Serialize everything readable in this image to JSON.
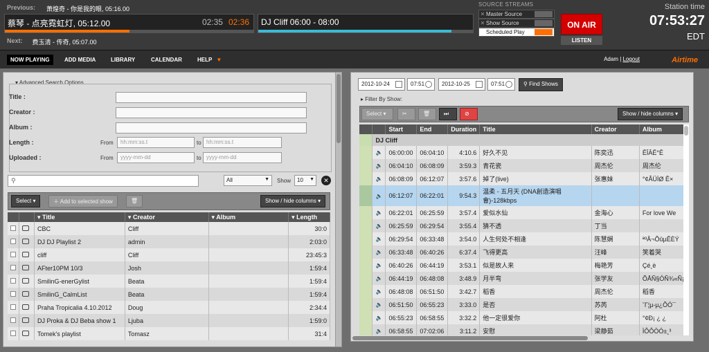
{
  "masthead": {
    "previous_label": "Previous:",
    "previous_text": "萧煌奇 - 你是我的眼, 05:16.00",
    "current_track": "蔡琴 - 点亮霓虹灯, 05:12.00",
    "current_elapsed": "02:35",
    "current_remaining": "02:36",
    "current_progress": 0.5,
    "current_show": "DJ Cliff  06:00 - 08:00",
    "show_progress": 0.9,
    "next_label": "Next:",
    "next_text": "费玉清 - 传奇, 05:07.00",
    "source_streams_title": "SOURCE STREAMS",
    "sources": [
      {
        "name": "Master Source",
        "on": false
      },
      {
        "name": "Show Source",
        "on": false
      },
      {
        "name": "Scheduled Play",
        "on": true
      }
    ],
    "on_air": "ON AIR",
    "listen": "LISTEN",
    "station_time_label": "Station time",
    "station_time": "07:53:27",
    "timezone": "EDT"
  },
  "nav": {
    "items": [
      "NOW PLAYING",
      "ADD MEDIA",
      "LIBRARY",
      "CALENDAR",
      "HELP"
    ],
    "user": "Adam",
    "separator": "|",
    "logout": "Logout",
    "brand": "Airtime"
  },
  "library": {
    "advanced_search": "Advanced Search Options",
    "fields": [
      "Title :",
      "Creator :",
      "Album :",
      "Length :",
      "Uploaded :"
    ],
    "from": "From",
    "to": "to",
    "length_placeholder": "hh:mm:ss.t",
    "date_placeholder": "yyyy-mm-dd",
    "filter_all": "All",
    "show_label": "Show",
    "show_count": "10",
    "select": "Select",
    "add_to_show": "Add to selected show",
    "show_hide": "Show / hide columns",
    "columns": [
      "Title",
      "Creator",
      "Album",
      "Length"
    ],
    "rows": [
      {
        "title": "CBC",
        "creator": "Cliff",
        "album": "",
        "length": "30:0"
      },
      {
        "title": "DJ DJ Playlist 2",
        "creator": "admin",
        "album": "",
        "length": "2:03:0"
      },
      {
        "title": "cliff",
        "creator": "Cliff",
        "album": "",
        "length": "23:45:3"
      },
      {
        "title": "AFter10PM 10/3",
        "creator": "Josh",
        "album": "",
        "length": "1:59:4"
      },
      {
        "title": "SmilinG-enerGylist",
        "creator": "Beata",
        "album": "",
        "length": "1:59:4"
      },
      {
        "title": "SmilinG_CalmList",
        "creator": "Beata",
        "album": "",
        "length": "1:59:4"
      },
      {
        "title": "Praha Tropicalia 4.10.2012",
        "creator": "Doug",
        "album": "",
        "length": "2:34:4"
      },
      {
        "title": "DJ Proka & DJ Beba show 1",
        "creator": "Ljuba",
        "album": "",
        "length": "1:59:0"
      },
      {
        "title": "Tomek's playlist",
        "creator": "Tomasz",
        "album": "",
        "length": "31:4"
      }
    ]
  },
  "schedule": {
    "start_date": "2012-10-24",
    "start_time": "07:51",
    "end_date": "2012-10-25",
    "end_time": "07:51",
    "find_shows": "Find Shows",
    "filter_by_show": "Filter By Show:",
    "select": "Select",
    "show_hide": "Show / hide columns",
    "columns": [
      "Start",
      "End",
      "Duration",
      "Title",
      "Creator",
      "Album"
    ],
    "show_name": "DJ Cliff",
    "rows": [
      {
        "start": "06:00:00",
        "end": "06:04:10",
        "dur": "4:10.6",
        "title": "好久不见",
        "creator": "陈奕迅",
        "album": "ÊÎÂÊ°Ê"
      },
      {
        "start": "06:04:10",
        "end": "06:08:09",
        "dur": "3:59.3",
        "title": "青花瓷",
        "creator": "周杰伦",
        "album": "周杰伦"
      },
      {
        "start": "06:08:09",
        "end": "06:12:07",
        "dur": "3:57.6",
        "title": "掉了(live)",
        "creator": "张惠妹",
        "album": "°¢ÃÜÌØ Ê×"
      },
      {
        "start": "06:12:07",
        "end": "06:22:01",
        "dur": "9:54.3",
        "title": "温柔 - 五月天 (DNA創造演唱會)-128kbps",
        "creator": "",
        "album": ""
      },
      {
        "start": "06:22:01",
        "end": "06:25:59",
        "dur": "3:57.4",
        "title": "爱似水仙",
        "creator": "金海心",
        "album": "For love We"
      },
      {
        "start": "06:25:59",
        "end": "06:29:54",
        "dur": "3:55.4",
        "title": "猜不透",
        "creator": "丁当",
        "album": ""
      },
      {
        "start": "06:29:54",
        "end": "06:33:48",
        "dur": "3:54.0",
        "title": "人生何处不相逢",
        "creator": "陈慧娴",
        "album": "ª³Â¬ÕûµÊÈÝ"
      },
      {
        "start": "06:33:48",
        "end": "06:40:26",
        "dur": "6:37.4",
        "title": "飞得更高",
        "creator": "汪峰",
        "album": "笑着哭"
      },
      {
        "start": "06:40:26",
        "end": "06:44:19",
        "dur": "3:53.1",
        "title": "似是故人来",
        "creator": "梅艳芳",
        "album": "Çé¸è"
      },
      {
        "start": "06:44:19",
        "end": "06:48:08",
        "dur": "3:48.9",
        "title": "月半弯",
        "creator": "张学友",
        "album": "ÕÅÑ§ÓÑ¾«Ñ¡"
      },
      {
        "start": "06:48:08",
        "end": "06:51:50",
        "dur": "3:42.7",
        "title": "稻香",
        "creator": "周杰伦",
        "album": "稻香"
      },
      {
        "start": "06:51:50",
        "end": "06:55:23",
        "dur": "3:33.0",
        "title": "是否",
        "creator": "苏芮",
        "album": "ˇΓ¦µ-µ¿ÕÓ¯"
      },
      {
        "start": "06:55:23",
        "end": "06:58:55",
        "dur": "3:32.2",
        "title": "他一定很爱你",
        "creator": "阿杜",
        "album": "°¢Ð¡ ¿ ¿"
      },
      {
        "start": "06:58:55",
        "end": "07:02:06",
        "dur": "3:11.2",
        "title": "安慰",
        "creator": "梁静茹",
        "album": "ÌÔÔÒÓ±¸³"
      }
    ]
  }
}
